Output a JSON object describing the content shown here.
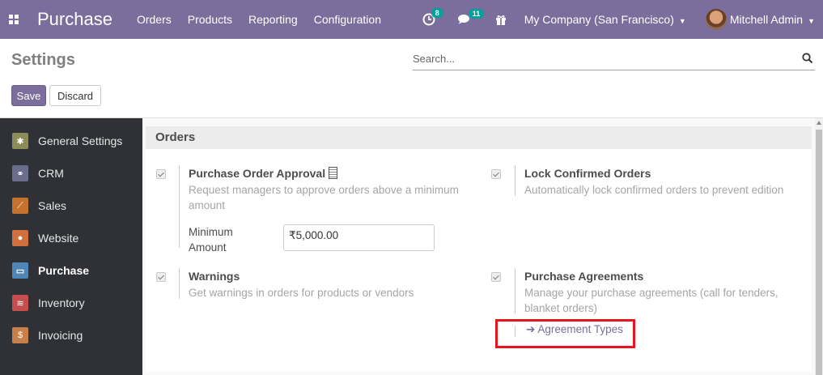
{
  "navbar": {
    "app_name": "Purchase",
    "menu": [
      "Orders",
      "Products",
      "Reporting",
      "Configuration"
    ],
    "activity_count": "8",
    "messages_count": "11",
    "company": "My Company (San Francisco)",
    "user": "Mitchell Admin"
  },
  "control_panel": {
    "title": "Settings",
    "search_placeholder": "Search...",
    "save_label": "Save",
    "discard_label": "Discard"
  },
  "sidebar": {
    "items": [
      {
        "label": "General Settings",
        "icon": "gear-icon",
        "color": "#8c8c5a"
      },
      {
        "label": "CRM",
        "icon": "handshake-icon",
        "color": "#6a6d8c"
      },
      {
        "label": "Sales",
        "icon": "chart-line-icon",
        "color": "#c4722e"
      },
      {
        "label": "Website",
        "icon": "globe-icon",
        "color": "#d1703e"
      },
      {
        "label": "Purchase",
        "icon": "credit-card-icon",
        "color": "#4f86b8"
      },
      {
        "label": "Inventory",
        "icon": "boxes-icon",
        "color": "#c44e4e"
      },
      {
        "label": "Invoicing",
        "icon": "invoice-icon",
        "color": "#c8804a"
      }
    ],
    "active": "Purchase"
  },
  "section": {
    "title": "Orders",
    "settings": [
      {
        "title": "Purchase Order Approval",
        "description": "Request managers to approve orders above a minimum amount",
        "checked": true
      },
      {
        "title": "Lock Confirmed Orders",
        "description": "Automatically lock confirmed orders to prevent edition",
        "checked": true
      },
      {
        "title": "Warnings",
        "description": "Get warnings in orders for products or vendors",
        "checked": true
      },
      {
        "title": "Purchase Agreements",
        "description": "Manage your purchase agreements (call for tenders, blanket orders)",
        "checked": true
      }
    ],
    "min_amount_label_1": "Minimum",
    "min_amount_label_2": "Amount",
    "min_amount_value": "₹5,000.00",
    "agreement_link": "Agreement Types"
  },
  "colors": {
    "brand": "#7c6e9c",
    "highlight": "#e8141e"
  }
}
